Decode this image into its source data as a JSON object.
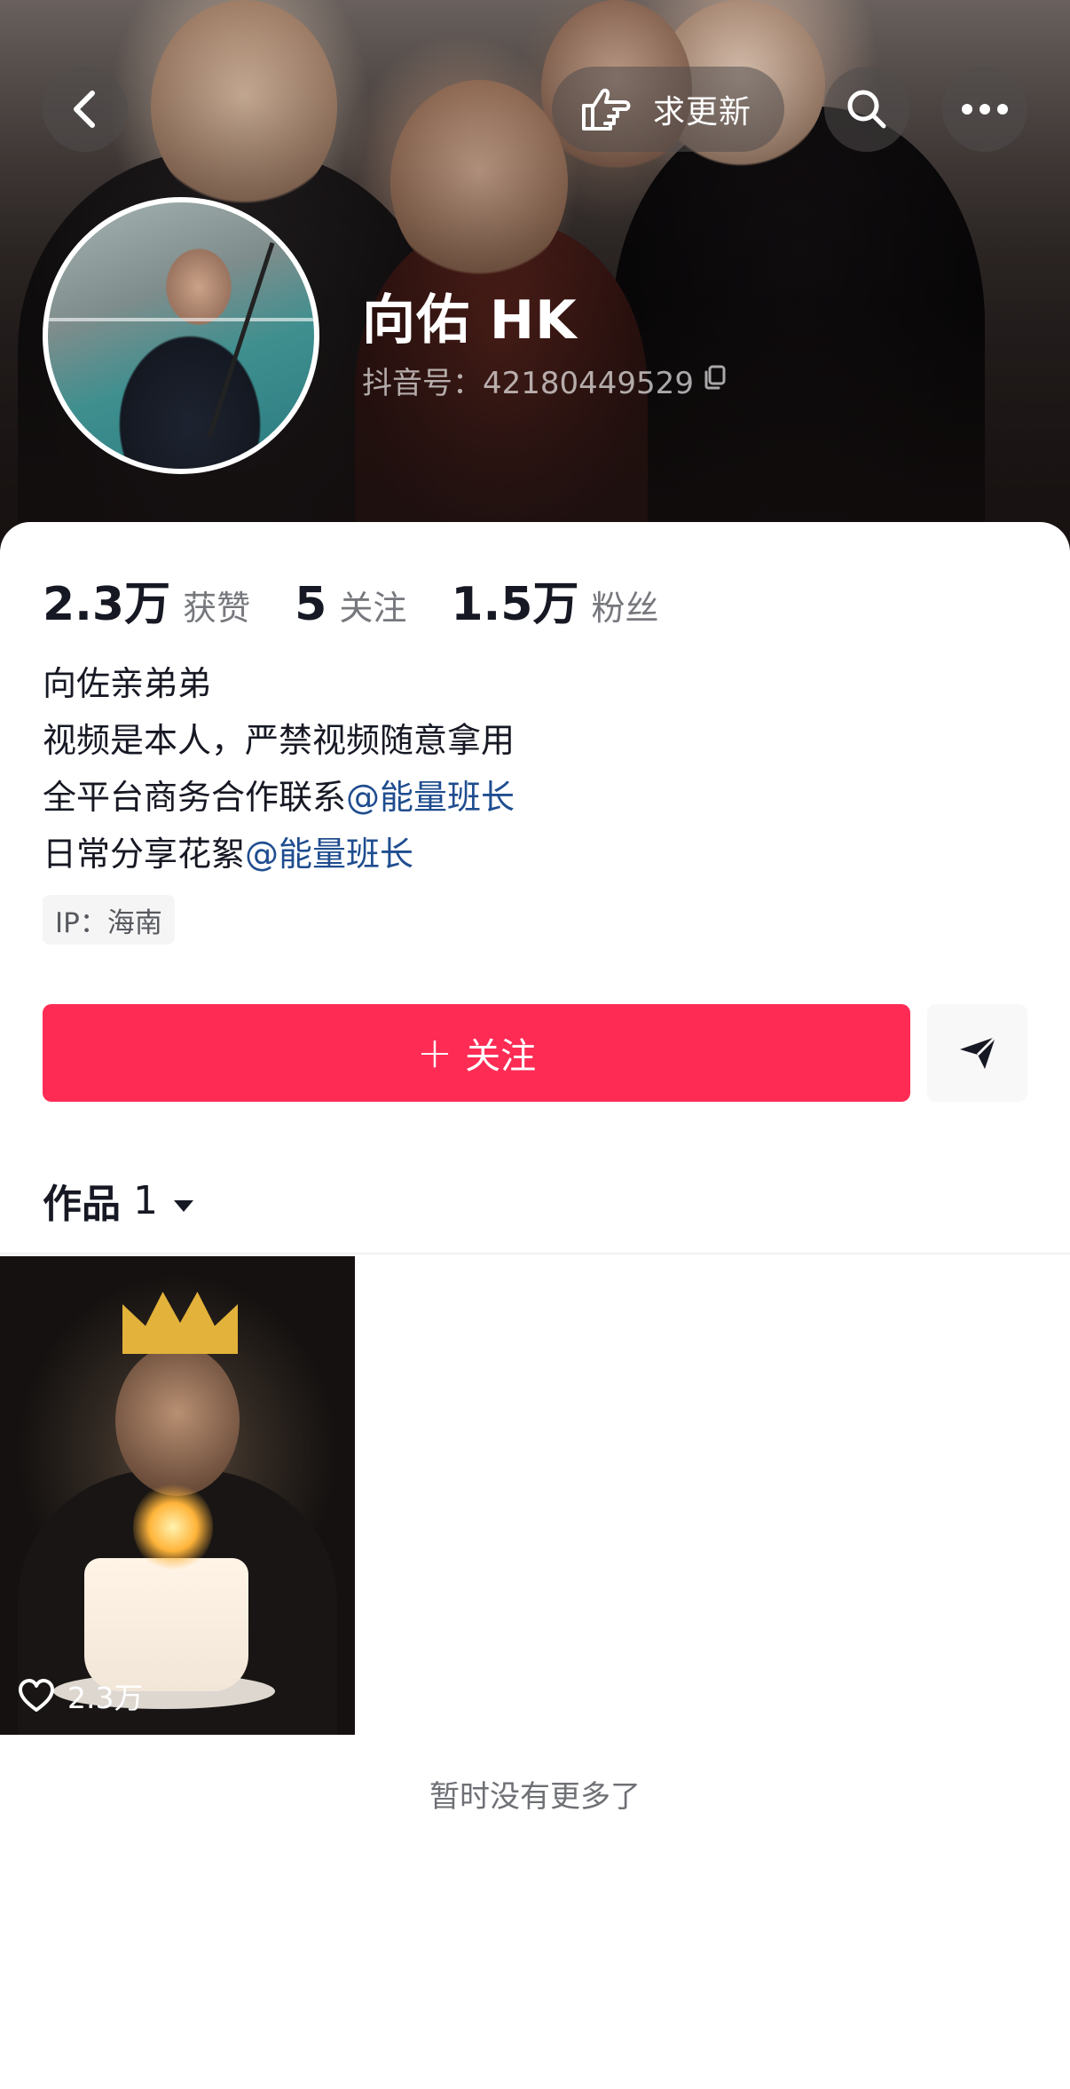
{
  "header": {
    "update_label": "求更新",
    "icons": {
      "back": "chevron-left-icon",
      "update": "pointing-hand-icon",
      "search": "search-icon",
      "more": "more-dots-icon"
    }
  },
  "profile": {
    "nickname": "向佑 HK",
    "douyin_id_label": "抖音号：42180449529",
    "stats": [
      {
        "value": "2.3万",
        "label": "获赞"
      },
      {
        "value": "5",
        "label": "关注"
      },
      {
        "value": "1.5万",
        "label": "粉丝"
      }
    ],
    "bio": {
      "line1": "向佐亲弟弟",
      "line2": "视频是本人，严禁视频随意拿用",
      "line3_text": "全平台商务合作联系",
      "line3_mention": "@能量班长",
      "line4_text": "日常分享花絮",
      "line4_mention": "@能量班长"
    },
    "ip_tag": "IP：海南"
  },
  "actions": {
    "follow_plus": "+",
    "follow_label": "关注"
  },
  "works": {
    "tab_label": "作品",
    "count": "1",
    "videos": [
      {
        "likes": "2.3万"
      }
    ],
    "footer": "暂时没有更多了"
  },
  "colors": {
    "accent": "#fe2c55",
    "mention": "#1f4d8f"
  }
}
